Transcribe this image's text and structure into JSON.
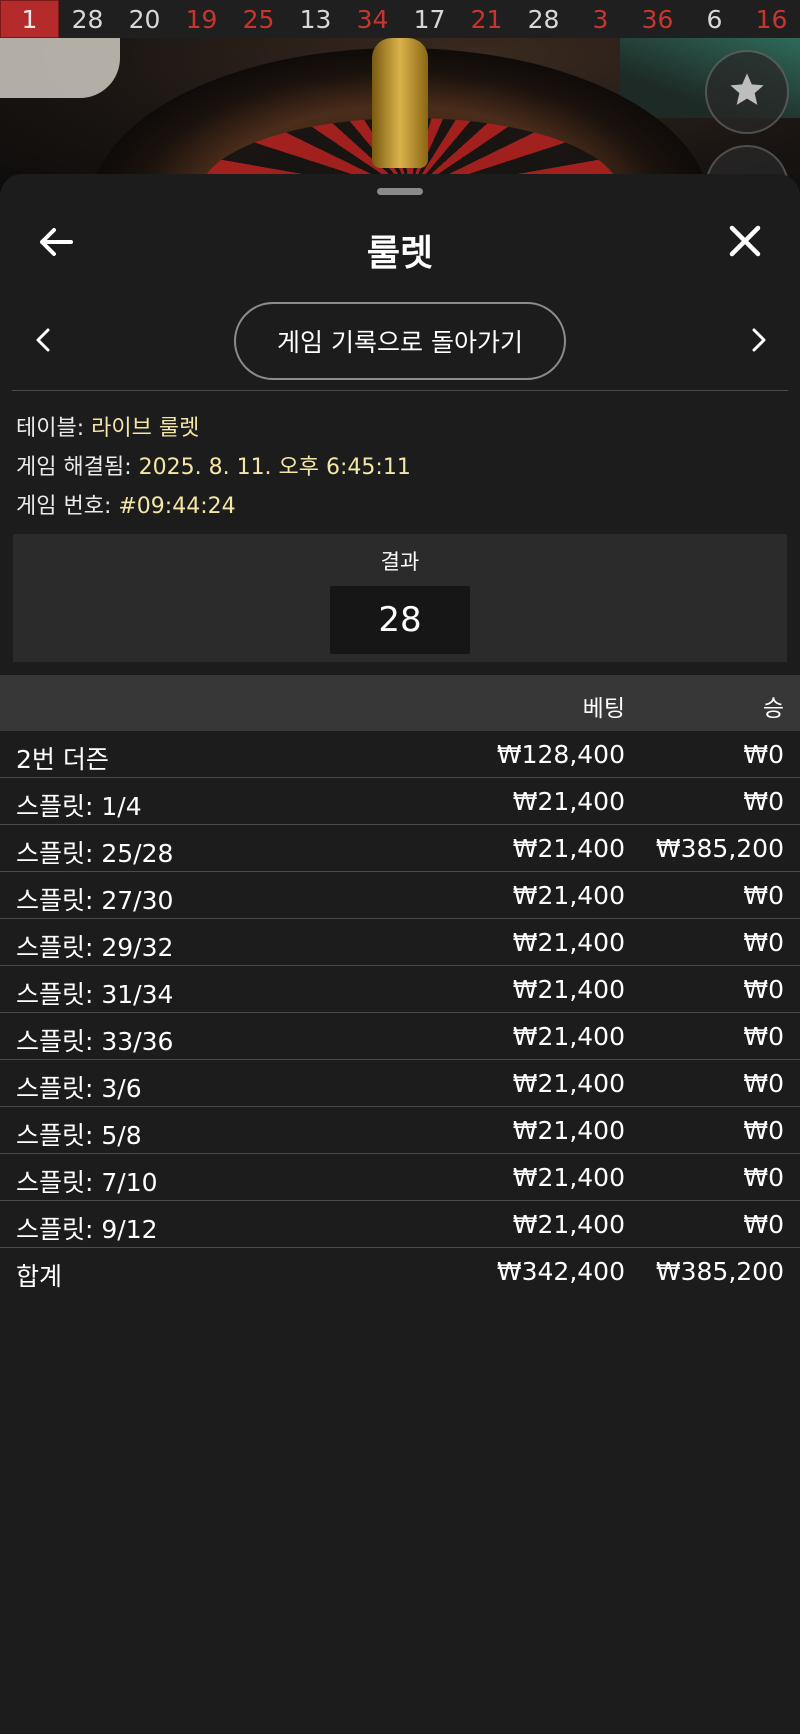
{
  "recent_results": [
    {
      "value": "1",
      "color": "red",
      "highlight": true
    },
    {
      "value": "28",
      "color": "black"
    },
    {
      "value": "20",
      "color": "black"
    },
    {
      "value": "19",
      "color": "red"
    },
    {
      "value": "25",
      "color": "red"
    },
    {
      "value": "13",
      "color": "black"
    },
    {
      "value": "34",
      "color": "red"
    },
    {
      "value": "17",
      "color": "black"
    },
    {
      "value": "21",
      "color": "red"
    },
    {
      "value": "28",
      "color": "black"
    },
    {
      "value": "3",
      "color": "red"
    },
    {
      "value": "36",
      "color": "red"
    },
    {
      "value": "6",
      "color": "black"
    },
    {
      "value": "16",
      "color": "red"
    }
  ],
  "header": {
    "title": "룰렛",
    "back_icon": "arrow-left-icon",
    "close_icon": "close-icon"
  },
  "nav": {
    "back_to_history_label": "게임 기록으로 돌아가기",
    "prev_icon": "chevron-left-icon",
    "next_icon": "chevron-right-icon"
  },
  "info": {
    "table_label": "테이블:",
    "table_value": "라이브 룰렛",
    "resolved_label": "게임 해결됨:",
    "resolved_value": "2025. 8. 11. 오후 6:45:11",
    "game_no_label": "게임 번호:",
    "game_no_value": "#09:44:24"
  },
  "result": {
    "label": "결과",
    "value": "28"
  },
  "bets_table": {
    "columns": [
      "",
      "베팅",
      "승"
    ],
    "rows": [
      {
        "bet": "2번 더즌",
        "amount": "₩128,400",
        "win": "₩0"
      },
      {
        "bet": "스플릿: 1/4",
        "amount": "₩21,400",
        "win": "₩0"
      },
      {
        "bet": "스플릿: 25/28",
        "amount": "₩21,400",
        "win": "₩385,200"
      },
      {
        "bet": "스플릿: 27/30",
        "amount": "₩21,400",
        "win": "₩0"
      },
      {
        "bet": "스플릿: 29/32",
        "amount": "₩21,400",
        "win": "₩0"
      },
      {
        "bet": "스플릿: 31/34",
        "amount": "₩21,400",
        "win": "₩0"
      },
      {
        "bet": "스플릿: 33/36",
        "amount": "₩21,400",
        "win": "₩0"
      },
      {
        "bet": "스플릿: 3/6",
        "amount": "₩21,400",
        "win": "₩0"
      },
      {
        "bet": "스플릿: 5/8",
        "amount": "₩21,400",
        "win": "₩0"
      },
      {
        "bet": "스플릿: 7/10",
        "amount": "₩21,400",
        "win": "₩0"
      },
      {
        "bet": "스플릿: 9/12",
        "amount": "₩21,400",
        "win": "₩0"
      }
    ],
    "total": {
      "label": "합계",
      "amount": "₩342,400",
      "win": "₩385,200"
    }
  },
  "colors": {
    "red_number": "#c8352f",
    "highlight_bg": "#b52a2a",
    "info_value": "#f3e6a6",
    "sheet_bg": "#1c1c1c",
    "table_header_bg": "#373737"
  }
}
